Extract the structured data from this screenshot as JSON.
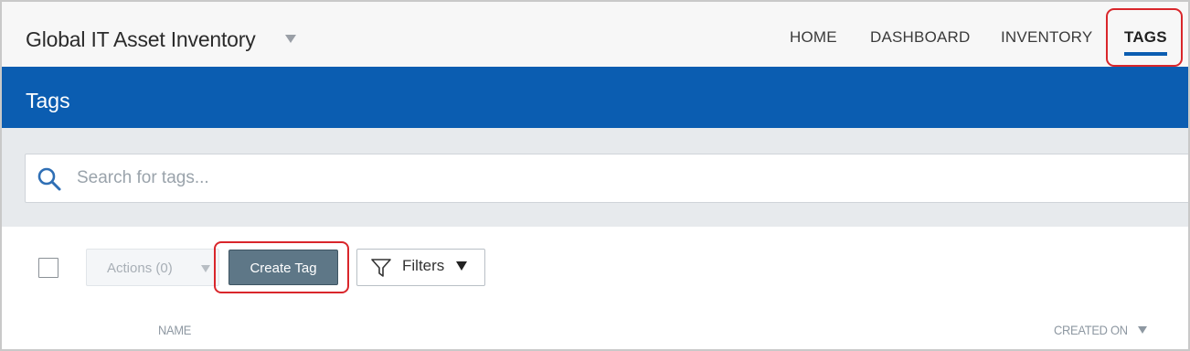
{
  "app": {
    "title": "Global IT Asset Inventory",
    "title_dropdown_icon": "caret-down-icon"
  },
  "nav": {
    "items": [
      {
        "label": "HOME"
      },
      {
        "label": "DASHBOARD"
      },
      {
        "label": "INVENTORY"
      },
      {
        "label": "TAGS",
        "active": true
      }
    ]
  },
  "page": {
    "title": "Tags"
  },
  "search": {
    "placeholder": "Search for tags...",
    "value": "",
    "icon": "search-icon"
  },
  "toolbar": {
    "actions_label": "Actions (0)",
    "actions_enabled": false,
    "create_label": "Create Tag",
    "filters_label": "Filters",
    "filters_icon": "filter-icon"
  },
  "table": {
    "columns": [
      {
        "label": "NAME"
      },
      {
        "label": "CREATED ON",
        "sorted": "desc"
      }
    ]
  },
  "colors": {
    "brand_blue": "#0b5db1",
    "highlight_red": "#d9262b",
    "primary_button": "#5e7787"
  }
}
